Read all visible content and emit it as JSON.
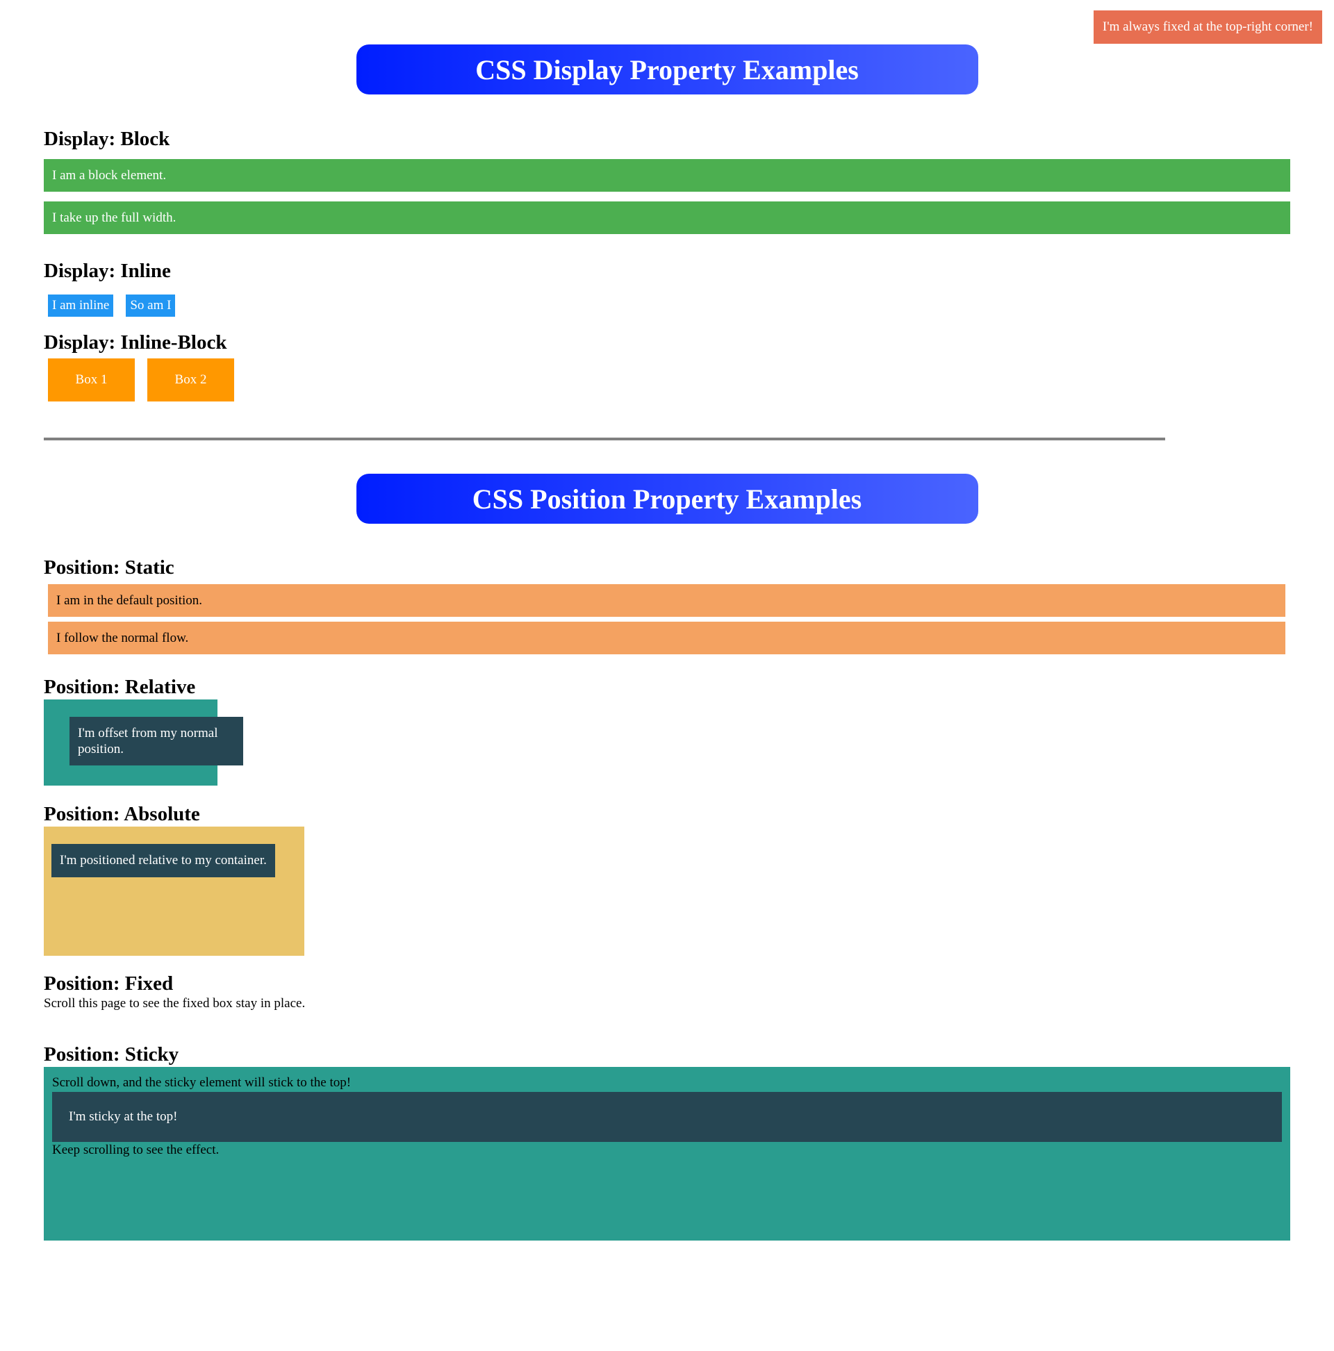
{
  "fixed_note": "I'm always fixed at the top-right corner!",
  "display_section": {
    "banner_title": "CSS Display Property Examples",
    "block": {
      "heading": "Display: Block",
      "items": [
        "I am a block element.",
        "I take up the full width."
      ]
    },
    "inline": {
      "heading": "Display: Inline",
      "items": [
        "I am inline",
        "So am I"
      ]
    },
    "inline_block": {
      "heading": "Display: Inline-Block",
      "items": [
        "Box 1",
        "Box 2"
      ]
    }
  },
  "position_section": {
    "banner_title": "CSS Position Property Examples",
    "static": {
      "heading": "Position: Static",
      "items": [
        "I am in the default position.",
        "I follow the normal flow."
      ]
    },
    "relative": {
      "heading": "Position: Relative",
      "inner_text": "I'm offset from my normal position."
    },
    "absolute": {
      "heading": "Position: Absolute",
      "inner_text": "I'm positioned relative to my container."
    },
    "fixed": {
      "heading": "Position: Fixed",
      "text": "Scroll this page to see the fixed box stay in place."
    },
    "sticky": {
      "heading": "Position: Sticky",
      "intro": "Scroll down, and the sticky element will stick to the top!",
      "sticky_text": "I'm sticky at the top!",
      "outro": "Keep scrolling to see the effect."
    }
  },
  "colors": {
    "fixed_note": "#e76f51",
    "banner_start": "#001eff",
    "banner_end": "#4a64ff",
    "block": "#4caf50",
    "inline": "#2196f3",
    "inline_block": "#ff9800",
    "static": "#f4a261",
    "teal": "#2a9d8f",
    "dark": "#264653",
    "absolute_container": "#e9c46a",
    "separator": "#808080"
  }
}
